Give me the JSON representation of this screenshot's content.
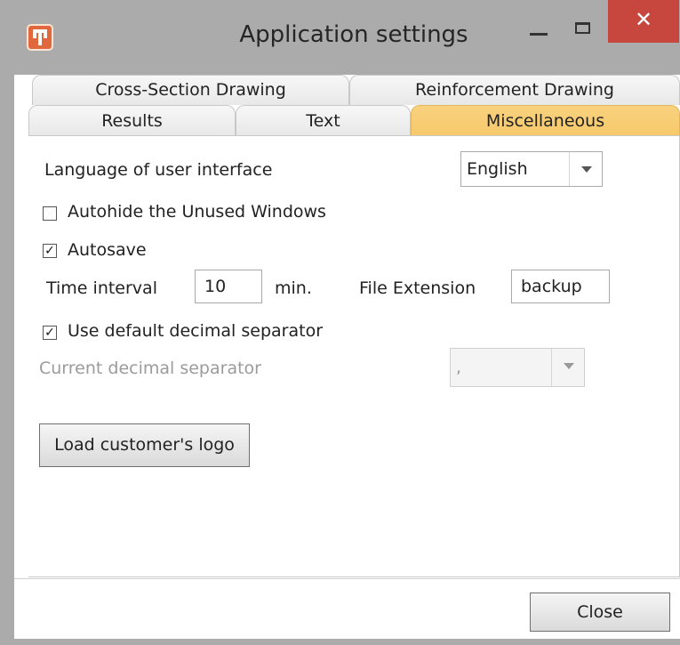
{
  "window": {
    "title": "Application settings",
    "close_glyph": "✕",
    "icons": {
      "app": "app-logo-icon",
      "minimize": "minimize-icon",
      "maximize": "maximize-icon",
      "close": "close-icon"
    },
    "colors": {
      "active_tab": "#f6c96a",
      "close_button": "#c7463e",
      "frame": "#ababab"
    }
  },
  "tabs": {
    "row1": [
      "Cross-Section Drawing",
      "Reinforcement Drawing"
    ],
    "row2": [
      "Results",
      "Text",
      "Miscellaneous"
    ],
    "active": "Miscellaneous"
  },
  "misc": {
    "language_label": "Language of user interface",
    "language_value": "English",
    "autohide_label": "Autohide the Unused Windows",
    "autohide_checked": false,
    "autosave_label": "Autosave",
    "autosave_checked": true,
    "checkmark": "✓",
    "time_interval_label": "Time interval",
    "time_interval_value": "10",
    "time_unit": "min.",
    "file_extension_label": "File Extension",
    "file_extension_value": "backup",
    "decimal_default_label": "Use default decimal separator",
    "decimal_default_checked": true,
    "current_decimal_label": "Current decimal separator",
    "current_decimal_value": ",",
    "load_logo_button": "Load customer's logo"
  },
  "footer": {
    "close_button": "Close"
  }
}
